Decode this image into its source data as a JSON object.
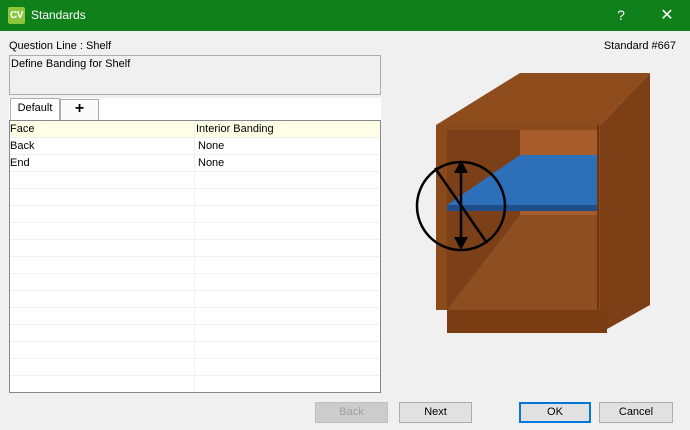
{
  "window": {
    "app_icon_text": "CV",
    "title": "Standards",
    "help_symbol": "?",
    "close_symbol": "✕"
  },
  "question_line_label": "Question Line : Shelf",
  "standard_number": "Standard #667",
  "description": "Define Banding for Shelf",
  "tabs": [
    {
      "label": "Default"
    },
    {
      "label": "+"
    }
  ],
  "grid": {
    "columns": [
      "Face",
      "Interior Banding"
    ],
    "rows": [
      [
        "Back",
        "None"
      ],
      [
        "End",
        "None"
      ]
    ],
    "empty_rows": 13
  },
  "buttons": {
    "back": "Back",
    "next": "Next",
    "ok": "OK",
    "cancel": "Cancel"
  },
  "illustration": {
    "name": "cabinet-shelf-illustration",
    "colors": {
      "cabinet_dark": "#7a3f13",
      "cabinet_mid": "#8b4a1c",
      "cabinet_light": "#9a5527",
      "back_panel": "#a7592a",
      "shelf_top": "#2b6ab4",
      "shelf_edge": "#1d4f8a"
    }
  },
  "colors": {
    "titlebar": "#10801a",
    "app_icon": "#8cc63f",
    "grid_header": "#fefee6",
    "accent_focus": "#0078d7"
  }
}
